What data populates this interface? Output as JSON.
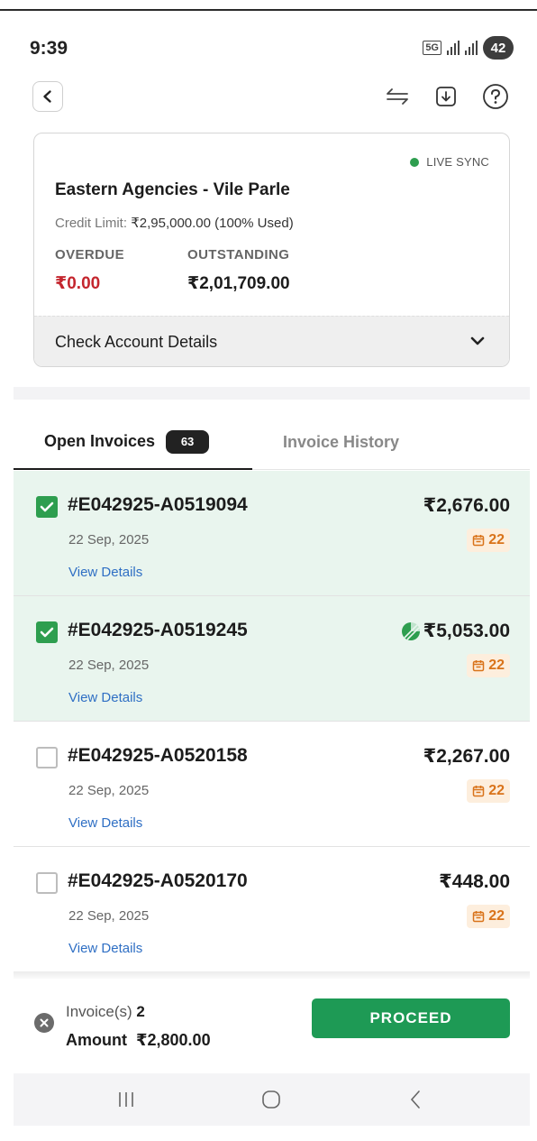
{
  "status_bar": {
    "time": "9:39",
    "network": "5G",
    "battery": "42"
  },
  "app_bar": {
    "icons": [
      "back-arrow",
      "swap",
      "download",
      "help"
    ]
  },
  "account": {
    "sync_status": "LIVE SYNC",
    "name": "Eastern Agencies - Vile Parle",
    "credit_label": "Credit Limit:",
    "credit_value": "₹2,95,000.00 (100% Used)",
    "overdue_label": "OVERDUE",
    "overdue_value": "₹0.00",
    "outstanding_label": "OUTSTANDING",
    "outstanding_value": "₹2,01,709.00",
    "details_label": "Check Account Details",
    "colors": {
      "overdue": "#c4262e",
      "live": "#2e9e4f"
    }
  },
  "tabs": [
    {
      "label": "Open Invoices",
      "count": "63",
      "active": true
    },
    {
      "label": "Invoice History",
      "active": false
    }
  ],
  "invoices": [
    {
      "number": "#E042925-A0519094",
      "date": "22 Sep, 2025",
      "link": "View Details",
      "amount": "₹2,676.00",
      "days": "22",
      "selected": true,
      "partial": false
    },
    {
      "number": "#E042925-A0519245",
      "date": "22 Sep, 2025",
      "link": "View Details",
      "amount": "₹5,053.00",
      "days": "22",
      "selected": true,
      "partial": true
    },
    {
      "number": "#E042925-A0520158",
      "date": "22 Sep, 2025",
      "link": "View Details",
      "amount": "₹2,267.00",
      "days": "22",
      "selected": false,
      "partial": false
    },
    {
      "number": "#E042925-A0520170",
      "date": "22 Sep, 2025",
      "link": "View Details",
      "amount": "₹448.00",
      "days": "22",
      "selected": false,
      "partial": false
    }
  ],
  "summary": {
    "invoices_label": "Invoice(s)",
    "invoices_value": "2",
    "amount_label": "Amount",
    "amount_value": "₹2,800.00",
    "proceed_label": "PROCEED",
    "accent": "#1e9a55"
  }
}
